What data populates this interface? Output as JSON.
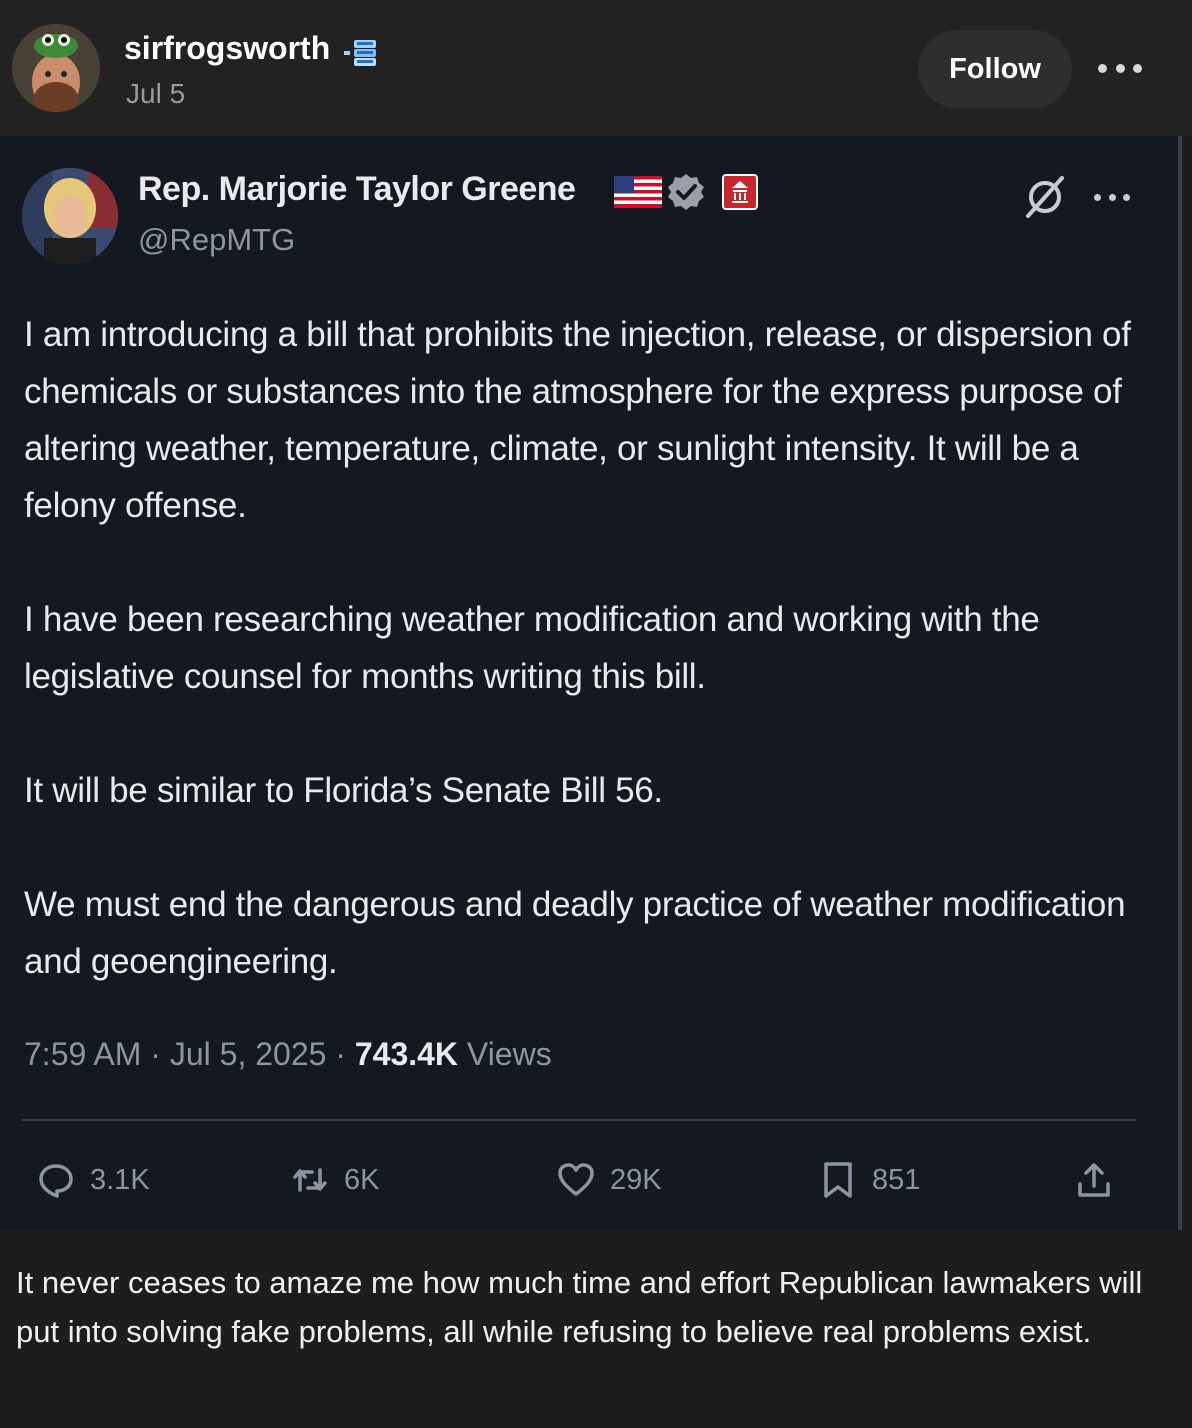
{
  "post": {
    "author": "sirfrogsworth",
    "date": "Jul 5",
    "follow_label": "Follow",
    "caption": "It never ceases to amaze me how much time and effort Republican lawmakers will put into solving fake problems, all while refusing to believe real problems exist."
  },
  "tweet": {
    "name": "Rep. Marjorie Taylor Greene",
    "handle": "@RepMTG",
    "paragraphs": [
      "I am introducing a bill that prohibits the injection, release, or dispersion of chemicals or substances into the atmosphere for the express purpose of altering weather, temperature, climate, or sunlight intensity. It will be a felony offense.",
      "I have been researching weather modification and working with the legislative counsel for months writing this bill.",
      "It will be similar to Florida’s Senate Bill 56.",
      "We must end the dangerous and deadly practice of weather modification and geoengineering."
    ],
    "time": "7:59 AM",
    "date": "Jul 5, 2025",
    "views_count": "743.4K",
    "views_label": "Views",
    "separator": "·",
    "stats": {
      "replies": "3.1K",
      "retweets": "6K",
      "likes": "29K",
      "bookmarks": "851"
    }
  },
  "icons": {
    "badge": "tumblr-blue-badge-icon",
    "flag": "us-flag-icon",
    "verified": "verified-check-icon",
    "government": "government-badge-icon",
    "grok": "grok-icon",
    "reply": "reply-icon",
    "retweet": "retweet-icon",
    "like": "heart-icon",
    "bookmark": "bookmark-icon",
    "share": "share-icon"
  },
  "colors": {
    "post_background": "#222222",
    "tweet_background": "#141920",
    "muted_text": "#8a96a3",
    "follow_button": "#2e2e2e"
  }
}
